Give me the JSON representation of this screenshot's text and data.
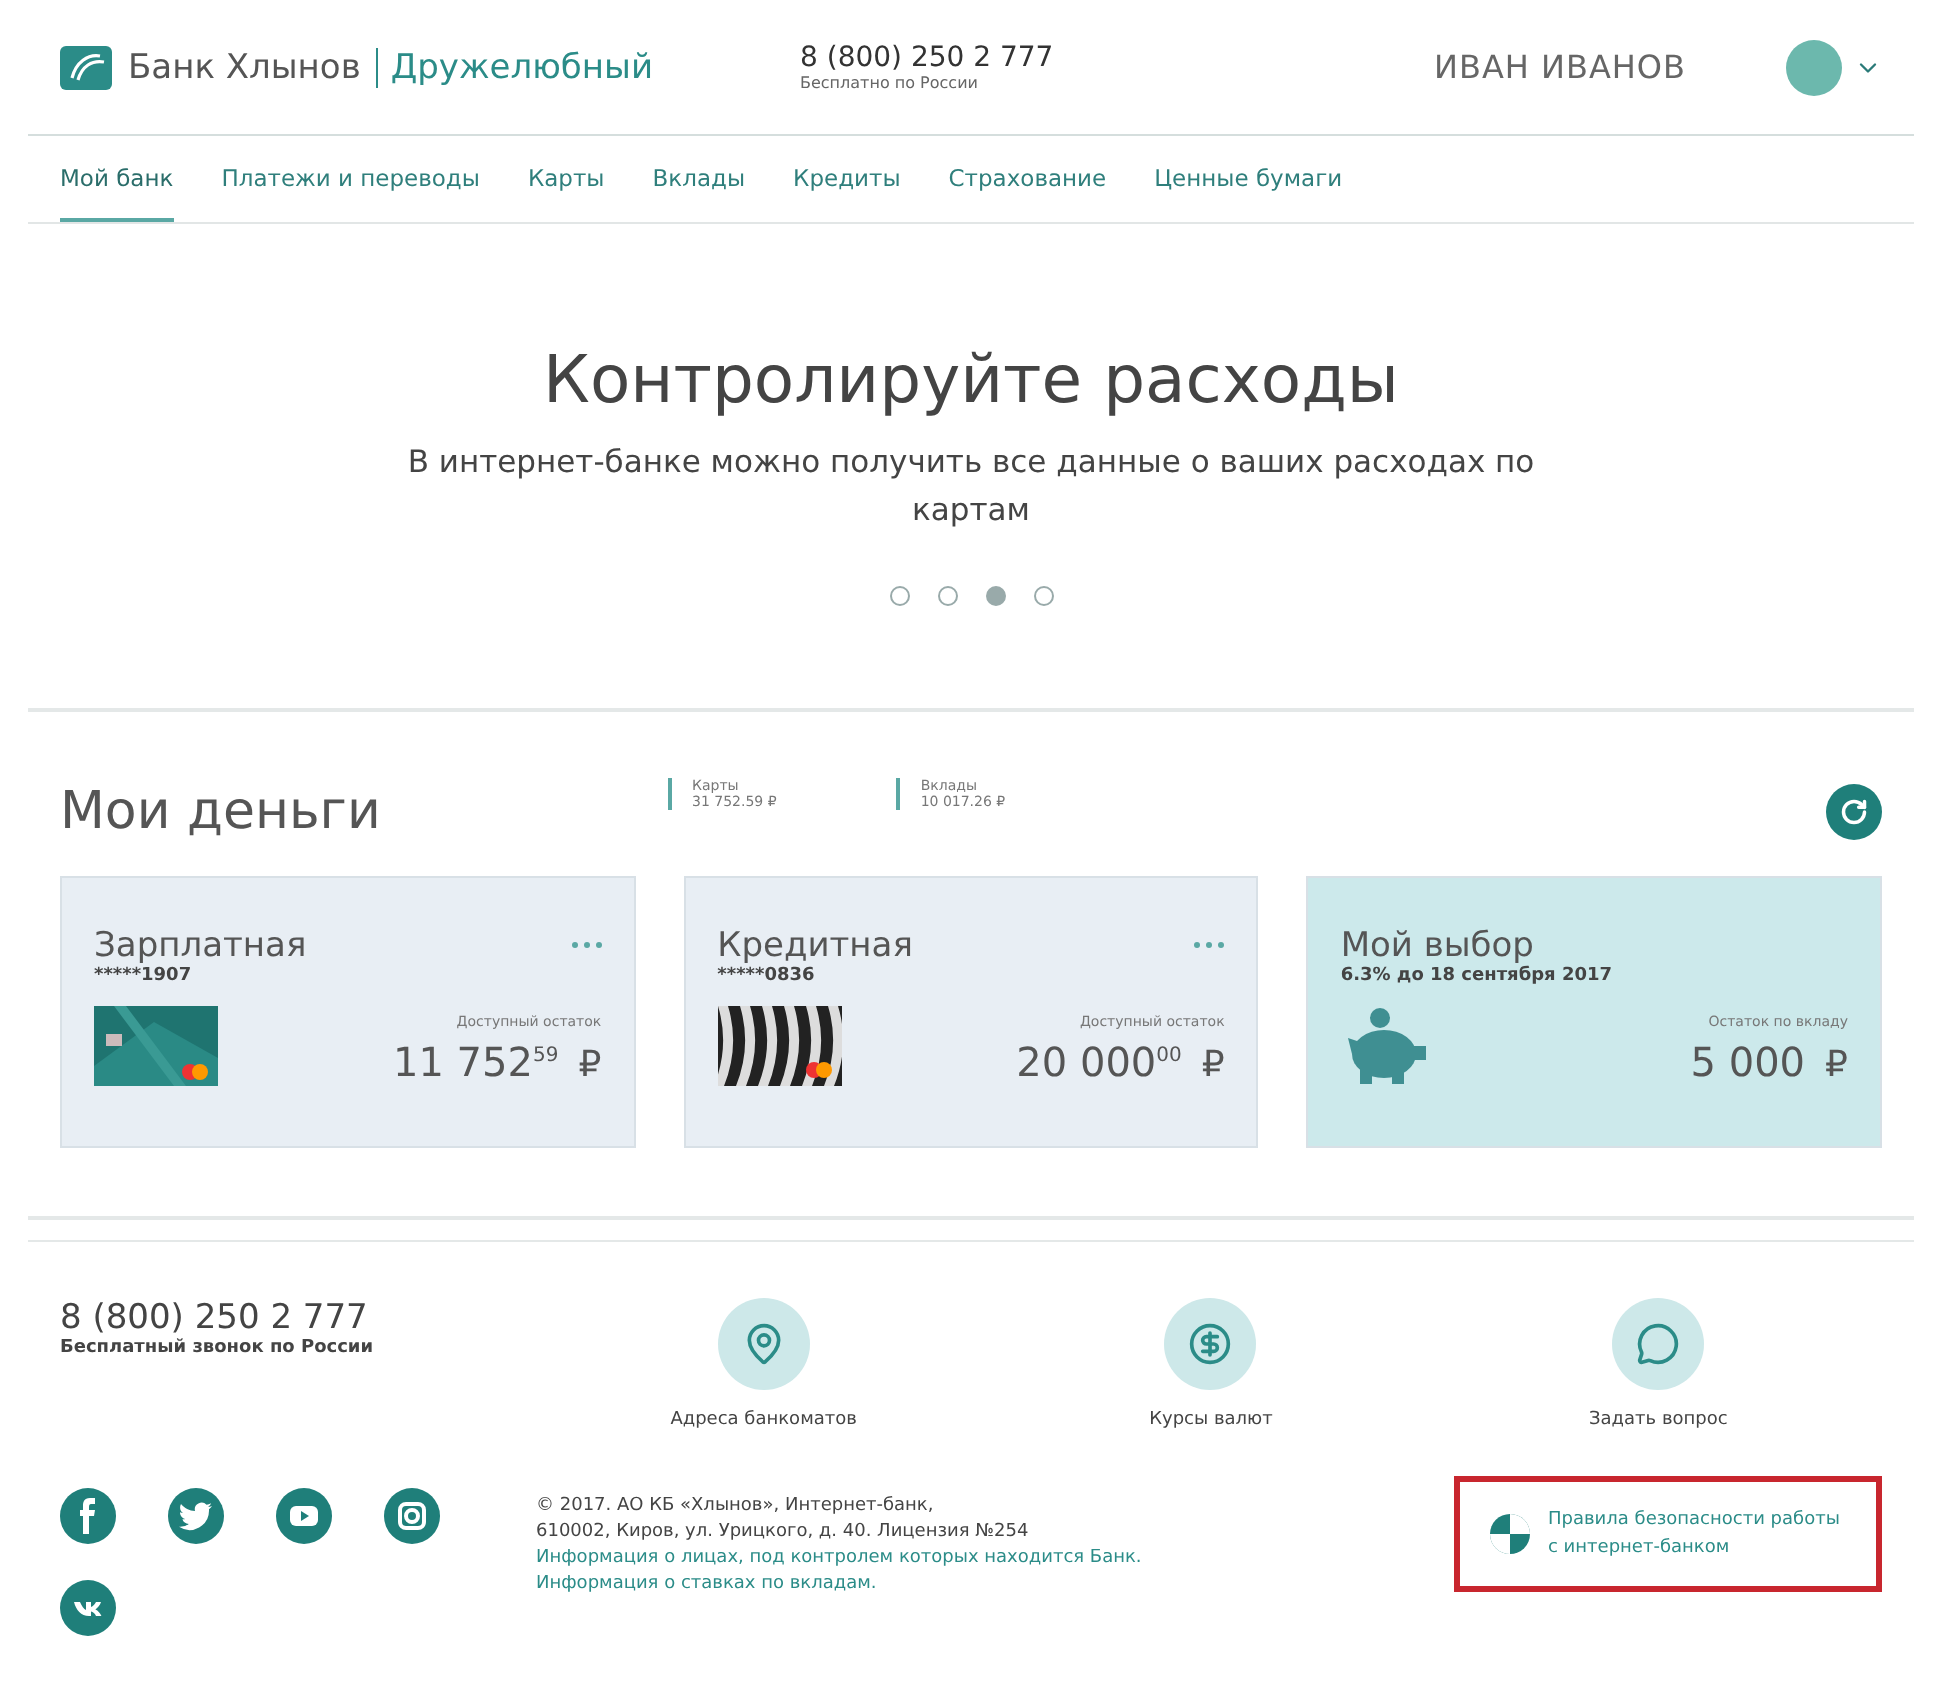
{
  "header": {
    "logo_name": "Банк Хлынов",
    "tagline": "Дружелюбный",
    "phone": "8 (800) 250 2 777",
    "phone_note": "Бесплатно по России",
    "user": "ИВАН ИВАНОВ"
  },
  "nav": [
    {
      "label": "Мой банк",
      "selected": true
    },
    {
      "label": "Платежи и переводы",
      "selected": false
    },
    {
      "label": "Карты",
      "selected": false
    },
    {
      "label": "Вклады",
      "selected": false
    },
    {
      "label": "Кредиты",
      "selected": false
    },
    {
      "label": "Страхование",
      "selected": false
    },
    {
      "label": "Ценные бумаги",
      "selected": false
    }
  ],
  "hero": {
    "title": "Контролируйте расходы",
    "text": "В интернет-банке можно получить все данные о ваших расходах по картам",
    "dots": [
      {
        "selected": false
      },
      {
        "selected": false
      },
      {
        "selected": true
      },
      {
        "selected": false
      }
    ]
  },
  "money": {
    "title": "Мои деньги",
    "summary": [
      {
        "label": "Карты",
        "value": "31 752.59 ₽"
      },
      {
        "label": "Вклады",
        "value": "10 017.26 ₽"
      }
    ],
    "products": [
      {
        "kind": "card",
        "name": "Зарплатная",
        "number": "*****1907",
        "balance_label": "Доступный остаток",
        "amount": "11 752$^{59}$",
        "currency": "₽"
      },
      {
        "kind": "card",
        "name": "Кредитная",
        "number": "*****0836",
        "balance_label": "Доступный остаток",
        "amount": "20 000$^{00}$",
        "currency": "₽"
      },
      {
        "kind": "deposit",
        "name": "Мой выбор",
        "rate": "6.3% до 18 сентября 2017",
        "balance_label": "Остаток по вкладу",
        "amount": "5 000",
        "currency": "₽"
      }
    ]
  },
  "footer": {
    "phone": "8 (800) 250 2 777",
    "phone_note": "Бесплатный звонок по России",
    "services": [
      {
        "kind": "pin",
        "label": "Адреса банкоматов"
      },
      {
        "kind": "dollar",
        "label": "Курсы валют"
      },
      {
        "kind": "chat",
        "label": "Задать вопрос"
      }
    ],
    "social": [
      {
        "kind": "facebook"
      },
      {
        "kind": "twitter"
      },
      {
        "kind": "youtube"
      },
      {
        "kind": "instagram"
      },
      {
        "kind": "vk"
      }
    ],
    "copyright": [
      "© 2017. АО КБ «Хлынов», Интернет-банк,",
      "610002, Киров, ул. Урицкого, д. 40. Лицензия №254"
    ],
    "links": [
      "Информация о лицах, под контролем которых находится Банк.",
      "Информация о ставках по вкладам."
    ],
    "security": "Правила безопасности работы с интернет-банком"
  }
}
